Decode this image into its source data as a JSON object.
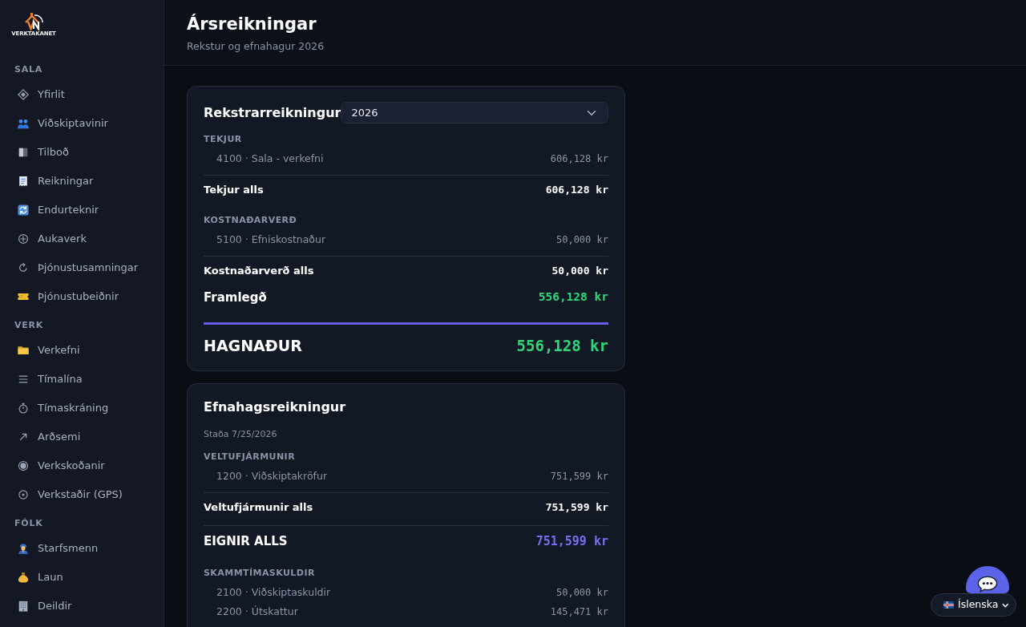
{
  "sidebar": {
    "logo": {
      "wordmark": "VERKTAKANET"
    },
    "sections": [
      {
        "title": "SALA",
        "items": [
          {
            "label": "Yfirlit",
            "selected": false
          },
          {
            "label": "Viðskiptavinir",
            "selected": false
          },
          {
            "label": "Tilboð",
            "selected": false
          },
          {
            "label": "Reikningar",
            "selected": false
          },
          {
            "label": "Endurteknir",
            "selected": false
          },
          {
            "label": "Aukaverk",
            "selected": false
          },
          {
            "label": "Þjónustusamningar",
            "selected": false
          },
          {
            "label": "Þjónustubeiðnir",
            "selected": false
          }
        ]
      },
      {
        "title": "VERK",
        "items": [
          {
            "label": "Verkefni",
            "selected": false
          },
          {
            "label": "Tímalína",
            "selected": false
          },
          {
            "label": "Tímaskráning",
            "selected": false
          },
          {
            "label": "Arðsemi",
            "selected": false
          },
          {
            "label": "Verkskoðanir",
            "selected": false
          },
          {
            "label": "Verkstaðir (GPS)",
            "selected": false
          }
        ]
      },
      {
        "title": "FÓLK",
        "items": [
          {
            "label": "Starfsmenn",
            "selected": false
          },
          {
            "label": "Laun",
            "selected": false
          },
          {
            "label": "Deildir",
            "selected": false
          }
        ]
      }
    ]
  },
  "header": {
    "title": "Ársreikningar",
    "subtitle": "Rekstur og efnahagur 2026"
  },
  "income_statement": {
    "title": "Rekstrarreikningur",
    "year_select": {
      "value": "2026"
    },
    "rows": [
      {
        "kind": "heading",
        "label": "TEKJUR"
      },
      {
        "kind": "line",
        "label": "4100 · Sala - verkefni",
        "amount": "606,128 kr"
      },
      {
        "kind": "total",
        "label": "Tekjur alls",
        "amount": "606,128 kr"
      },
      {
        "kind": "heading",
        "label": "KOSTNAÐARVERÐ"
      },
      {
        "kind": "line",
        "label": "5100 · Efniskostnaður",
        "amount": "50,000 kr"
      },
      {
        "kind": "total",
        "label": "Kostnaðarverð alls",
        "amount": "50,000 kr"
      },
      {
        "kind": "margin",
        "label": "Framlegð",
        "amount": "556,128 kr"
      },
      {
        "kind": "result",
        "label": "HAGNAÐUR",
        "amount": "556,128 kr"
      }
    ]
  },
  "balance_sheet": {
    "title": "Efnahagsreikningur",
    "as_of": "Staða 7/25/2026",
    "rows": [
      {
        "kind": "heading",
        "label": "VELTUFJÁRMUNIR"
      },
      {
        "kind": "line",
        "label": "1200 · Viðskiptakröfur",
        "amount": "751,599 kr"
      },
      {
        "kind": "total",
        "label": "Veltufjármunir alls",
        "amount": "751,599 kr"
      },
      {
        "kind": "grand_total",
        "label": "EIGNIR ALLS",
        "amount": "751,599 kr"
      },
      {
        "kind": "heading",
        "label": "SKAMMTÍMASKULDIR"
      },
      {
        "kind": "line",
        "label": "2100 · Viðskiptaskuldir",
        "amount": "50,000 kr"
      },
      {
        "kind": "line",
        "label": "2200 · Útskattur",
        "amount": "145,471 kr"
      }
    ]
  },
  "language_select": {
    "value": "Íslenska"
  }
}
